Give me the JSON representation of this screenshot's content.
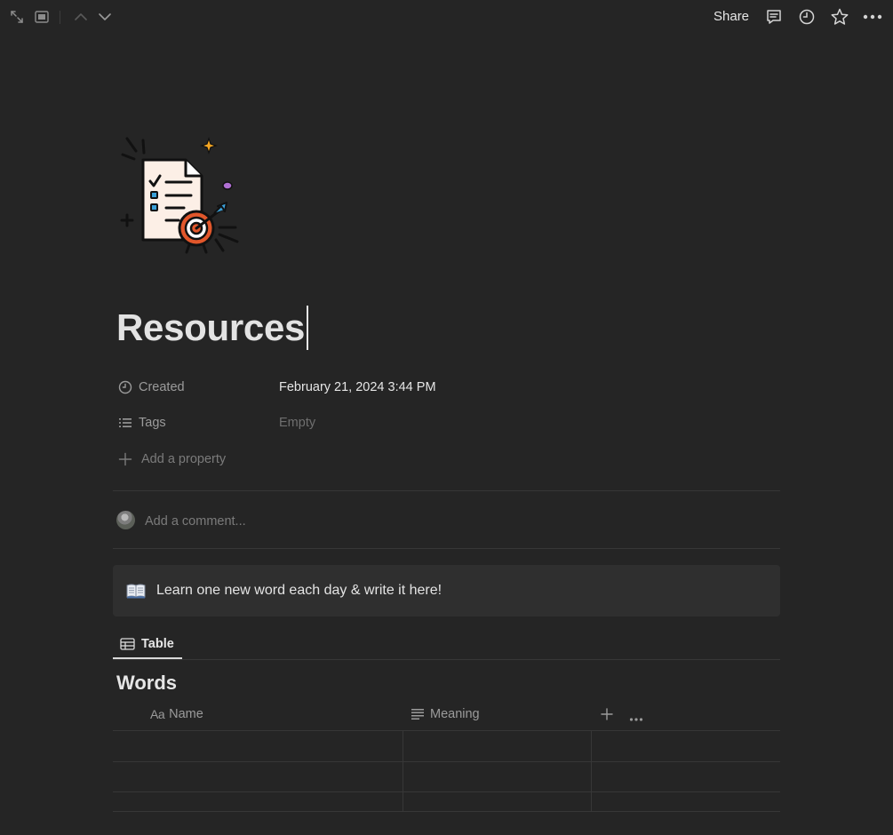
{
  "topbar": {
    "share_label": "Share",
    "icons": [
      "expand-icon",
      "sidebar-peek-icon",
      "chevron-up-icon",
      "chevron-down-icon",
      "comment-icon",
      "history-clock-icon",
      "star-icon",
      "more-dots-icon"
    ]
  },
  "page": {
    "icon": "checklist-target-illustration",
    "title": "Resources"
  },
  "properties": [
    {
      "name": "Created",
      "value": "February 21, 2024 3:44 PM",
      "icon": "clock-icon"
    },
    {
      "name": "Tags",
      "value": "Empty",
      "icon": "list-icon"
    }
  ],
  "add_property_label": "Add a property",
  "comment": {
    "placeholder": "Add a comment..."
  },
  "callout": {
    "icon": "open-book-icon",
    "text": "Learn one new word each day & write it  here!"
  },
  "view": {
    "tab_label": "Table",
    "icon": "table-icon"
  },
  "database": {
    "title": "Words",
    "name_prefix": "Aa",
    "columns": [
      "Name",
      "Meaning"
    ],
    "rows": [
      [
        "",
        ""
      ],
      [
        "",
        ""
      ]
    ]
  },
  "colors": {
    "background": "#252525",
    "text": "#e3e3e3",
    "muted": "#9b9b9b",
    "callout_bg": "#2f2f2f",
    "divider": "#373737"
  }
}
